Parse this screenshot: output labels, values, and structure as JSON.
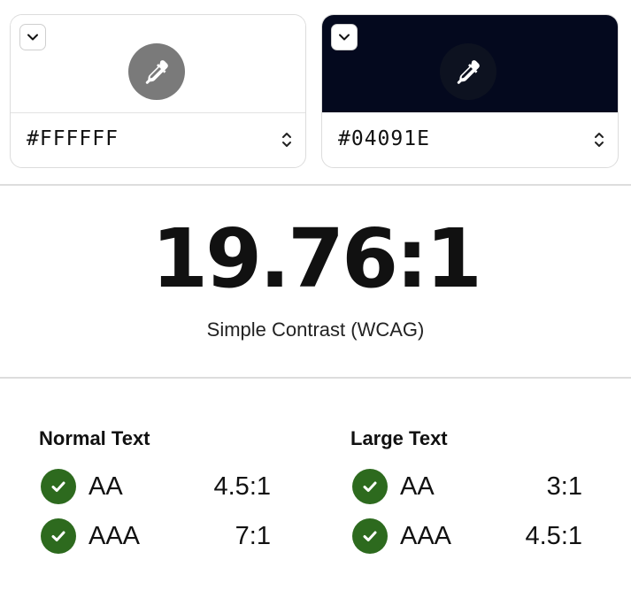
{
  "colors": {
    "foreground": {
      "hex": "#FFFFFF"
    },
    "background": {
      "hex": "#04091E"
    },
    "pass_check": "#2D6A1E"
  },
  "contrast": {
    "ratio": "19.76:1",
    "label": "Simple Contrast (WCAG)"
  },
  "results": {
    "normal_text": {
      "title": "Normal Text",
      "rows": [
        {
          "level": "AA",
          "requirement": "4.5:1",
          "status": "pass"
        },
        {
          "level": "AAA",
          "requirement": "7:1",
          "status": "pass"
        }
      ]
    },
    "large_text": {
      "title": "Large Text",
      "rows": [
        {
          "level": "AA",
          "requirement": "3:1",
          "status": "pass"
        },
        {
          "level": "AAA",
          "requirement": "4.5:1",
          "status": "pass"
        }
      ]
    }
  },
  "icons": {
    "toggle": "chevron-down-icon",
    "picker": "eyedropper-icon",
    "stepper": "chevron-up-down-icon",
    "pass": "check-circle-icon"
  }
}
